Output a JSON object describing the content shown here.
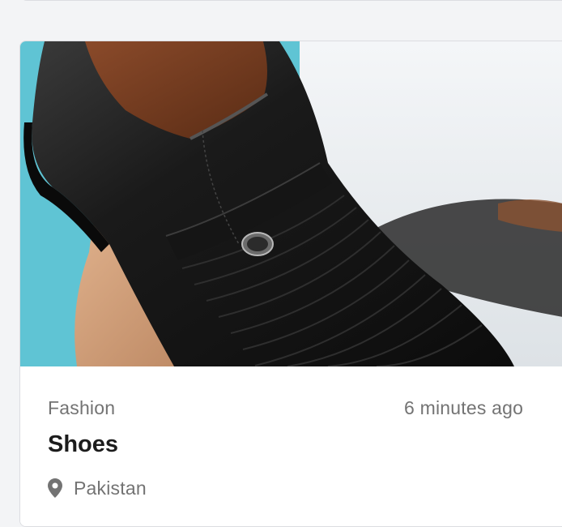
{
  "listing": {
    "category": "Fashion",
    "posted_time": "6 minutes ago",
    "title": "Shoes",
    "location": "Pakistan",
    "image_alt": "Black leather slip-on dress shoe held in hand"
  },
  "icons": {
    "location": "map-pin-icon"
  },
  "colors": {
    "page_background": "#f3f4f6",
    "card_background": "#ffffff",
    "card_border": "#dcdde1",
    "muted_text": "#737373",
    "title_text": "#1c1c1c"
  }
}
